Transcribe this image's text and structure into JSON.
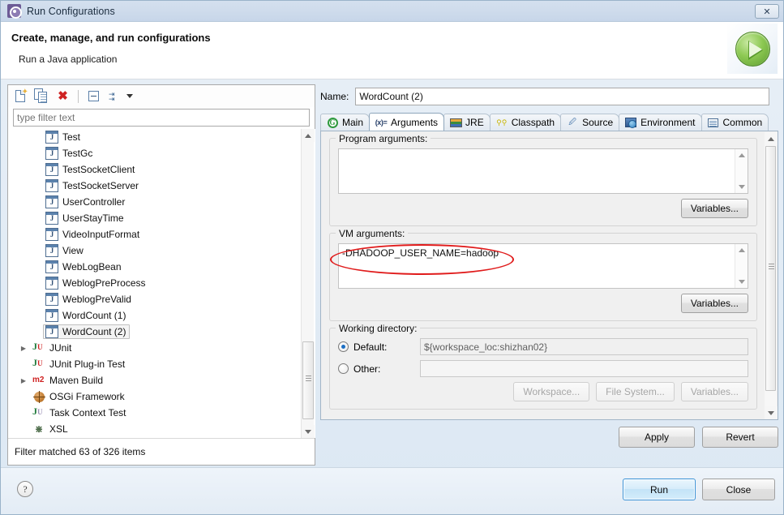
{
  "window": {
    "title": "Run Configurations",
    "title_icon": "gear-icon",
    "close_label": "✕"
  },
  "header": {
    "title": "Create, manage, and run configurations",
    "subtitle": "Run a Java application",
    "banner_icon": "run-play-icon"
  },
  "tree_toolbar": {
    "new_label": "new-configuration-icon",
    "duplicate_label": "duplicate-configuration-icon",
    "delete_label": "✖",
    "collapse_label": "collapse-all-icon",
    "filter_label": "filter-icon",
    "caret_label": "chevron-down-icon"
  },
  "filter": {
    "placeholder": "type filter text",
    "value": "",
    "status": "Filter matched 63 of 326 items"
  },
  "tree": {
    "items": [
      {
        "label": "Test",
        "icon": "java-application-icon",
        "indent": 1,
        "twisty": "",
        "selected": false
      },
      {
        "label": "TestGc",
        "icon": "java-application-icon",
        "indent": 1,
        "twisty": "",
        "selected": false
      },
      {
        "label": "TestSocketClient",
        "icon": "java-application-icon",
        "indent": 1,
        "twisty": "",
        "selected": false
      },
      {
        "label": "TestSocketServer",
        "icon": "java-application-icon",
        "indent": 1,
        "twisty": "",
        "selected": false
      },
      {
        "label": "UserController",
        "icon": "java-application-icon",
        "indent": 1,
        "twisty": "",
        "selected": false
      },
      {
        "label": "UserStayTime",
        "icon": "java-application-icon",
        "indent": 1,
        "twisty": "",
        "selected": false
      },
      {
        "label": "VideoInputFormat",
        "icon": "java-application-icon",
        "indent": 1,
        "twisty": "",
        "selected": false
      },
      {
        "label": "View",
        "icon": "java-application-icon",
        "indent": 1,
        "twisty": "",
        "selected": false
      },
      {
        "label": "WebLogBean",
        "icon": "java-application-icon",
        "indent": 1,
        "twisty": "",
        "selected": false
      },
      {
        "label": "WeblogPreProcess",
        "icon": "java-application-icon",
        "indent": 1,
        "twisty": "",
        "selected": false
      },
      {
        "label": "WeblogPreValid",
        "icon": "java-application-icon",
        "indent": 1,
        "twisty": "",
        "selected": false
      },
      {
        "label": "WordCount (1)",
        "icon": "java-application-icon",
        "indent": 1,
        "twisty": "",
        "selected": false
      },
      {
        "label": "WordCount (2)",
        "icon": "java-application-icon",
        "indent": 1,
        "twisty": "",
        "selected": true
      },
      {
        "label": "JUnit",
        "icon": "junit-icon",
        "indent": 0,
        "twisty": "▶",
        "selected": false
      },
      {
        "label": "JUnit Plug-in Test",
        "icon": "junit-plugin-icon",
        "indent": 0,
        "twisty": "",
        "selected": false
      },
      {
        "label": "Maven Build",
        "icon": "maven-icon",
        "indent": 0,
        "twisty": "▶",
        "selected": false
      },
      {
        "label": "OSGi Framework",
        "icon": "osgi-icon",
        "indent": 0,
        "twisty": "",
        "selected": false
      },
      {
        "label": "Task Context Test",
        "icon": "task-context-icon",
        "indent": 0,
        "twisty": "",
        "selected": false
      },
      {
        "label": "XSL",
        "icon": "xsl-icon",
        "indent": 0,
        "twisty": "",
        "selected": false
      }
    ]
  },
  "config": {
    "name_label": "Name:",
    "name_value": "WordCount (2)"
  },
  "tabs": [
    {
      "label": "Main",
      "icon": "main-icon",
      "active": false
    },
    {
      "label": "Arguments",
      "icon": "arguments-icon",
      "active": true
    },
    {
      "label": "JRE",
      "icon": "jre-icon",
      "active": false
    },
    {
      "label": "Classpath",
      "icon": "classpath-icon",
      "active": false
    },
    {
      "label": "Source",
      "icon": "source-icon",
      "active": false
    },
    {
      "label": "Environment",
      "icon": "environment-icon",
      "active": false
    },
    {
      "label": "Common",
      "icon": "common-icon",
      "active": false
    }
  ],
  "arguments_tab": {
    "program_args": {
      "group_title": "Program arguments:",
      "value": "",
      "variables_button": "Variables..."
    },
    "vm_args": {
      "group_title": "VM arguments:",
      "value": "-DHADOOP_USER_NAME=hadoop",
      "variables_button": "Variables..."
    },
    "working_directory": {
      "group_title": "Working directory:",
      "default_label": "Default:",
      "default_value": "${workspace_loc:shizhan02}",
      "default_selected": true,
      "other_label": "Other:",
      "other_value": "",
      "other_selected": false,
      "workspace_button": "Workspace...",
      "filesystem_button": "File System...",
      "variables_button": "Variables..."
    }
  },
  "actions": {
    "apply": "Apply",
    "revert": "Revert"
  },
  "footer": {
    "help_label": "?",
    "run": "Run",
    "close": "Close"
  },
  "annotation": {
    "type": "red-ellipse-highlight",
    "target": "vm-arguments-value",
    "color": "#e01b1b"
  }
}
